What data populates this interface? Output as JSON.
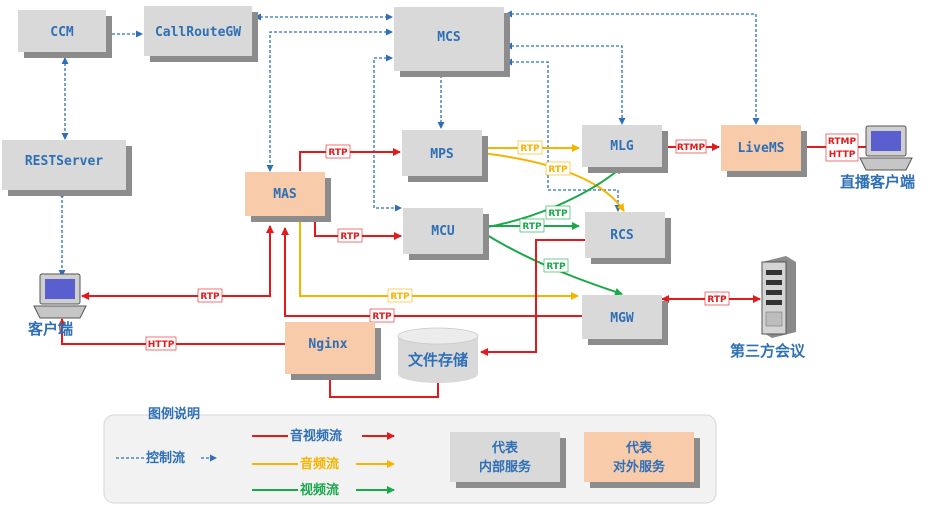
{
  "nodes": {
    "ccm": "CCM",
    "callroutegw": "CallRouteGW",
    "mcs": "MCS",
    "restserver": "RESTServer",
    "mps": "MPS",
    "mlg": "MLG",
    "livems": "LiveMS",
    "mas": "MAS",
    "mcu": "MCU",
    "rcs": "RCS",
    "mgw": "MGW",
    "nginx": "Nginx",
    "file_storage": "文件存储",
    "client": "客户端",
    "live_client": "直播客户端",
    "third_party": "第三方会议"
  },
  "protocols": {
    "rtp": "RTP",
    "rtmp": "RTMP",
    "http": "HTTP"
  },
  "legend": {
    "title": "图例说明",
    "control": "控制流",
    "av": "音视频流",
    "audio": "音频流",
    "video": "视频流",
    "internal": [
      "代表",
      "内部服务"
    ],
    "external": [
      "代表",
      "对外服务"
    ]
  },
  "colors": {
    "av": "#e31a1c",
    "audio": "#f5b400",
    "video": "#1aa84a",
    "control": "#2e6fb5",
    "internal_box": "#d9d9d9",
    "external_box": "#f8cbab",
    "shadow": "#8c8c8c"
  }
}
